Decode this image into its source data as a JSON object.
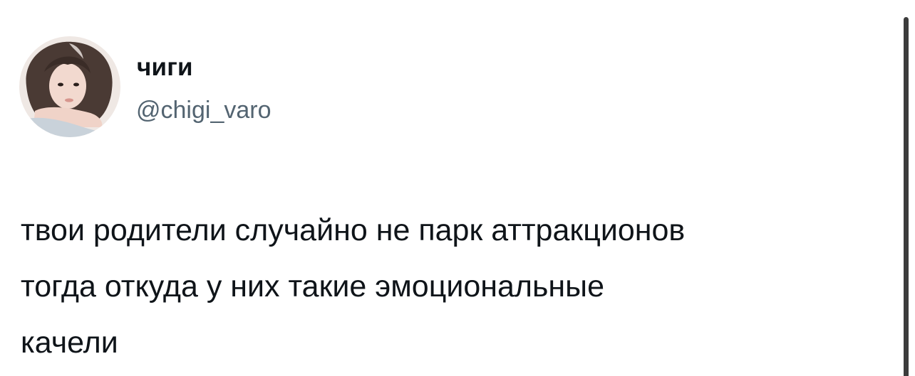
{
  "author": {
    "display_name": "чиги",
    "handle": "@chigi_varo",
    "avatar": "avatar-photo-icon"
  },
  "tweet": {
    "lines": [
      "твои родители случайно не парк аттракционов",
      "тогда откуда у них такие эмоциональные",
      "качели"
    ]
  },
  "colors": {
    "text": "#0f1419",
    "handle": "#536471",
    "background": "#ffffff",
    "scrollbar": "#3c3c3c"
  }
}
